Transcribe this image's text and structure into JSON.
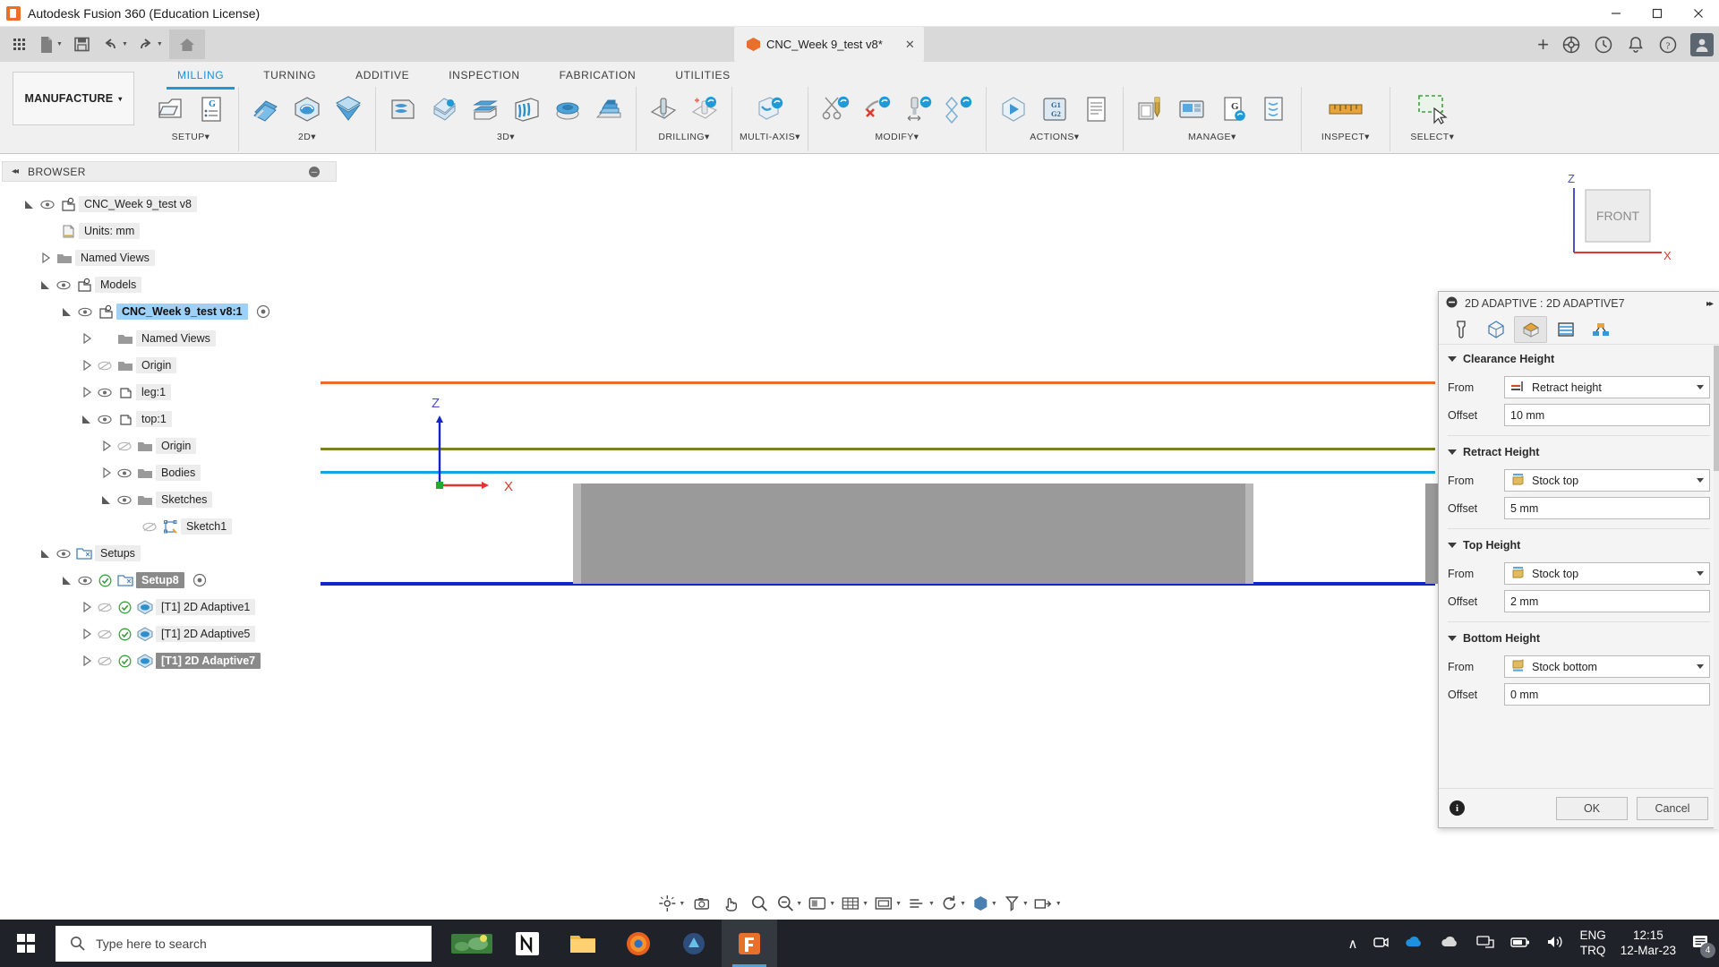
{
  "titlebar": {
    "app_title": "Autodesk Fusion 360 (Education License)",
    "minimize": "─",
    "maximize": "□",
    "close": "✕"
  },
  "quick_access": {
    "items": [
      {
        "name": "app-grid",
        "label": ""
      },
      {
        "name": "new-document",
        "label": ""
      },
      {
        "name": "save",
        "label": ""
      },
      {
        "name": "undo",
        "label": ""
      },
      {
        "name": "redo",
        "label": ""
      },
      {
        "name": "home",
        "label": ""
      }
    ],
    "document_tab": {
      "label": "CNC_Week 9_test v8*",
      "close": "✕"
    },
    "add_tab": "+"
  },
  "ribbon": {
    "workspace": "MANUFACTURE",
    "workspace_caret": "▾",
    "tabs": [
      {
        "label": "MILLING",
        "active": true
      },
      {
        "label": "TURNING",
        "active": false
      },
      {
        "label": "ADDITIVE",
        "active": false
      },
      {
        "label": "INSPECTION",
        "active": false
      },
      {
        "label": "FABRICATION",
        "active": false
      },
      {
        "label": "UTILITIES",
        "active": false
      }
    ],
    "panels": [
      {
        "label": "SETUP",
        "caret": "▾",
        "commands": [
          "setup-icon",
          "generate-nc-program-icon"
        ]
      },
      {
        "label": "2D",
        "caret": "▾",
        "commands": [
          "face-icon",
          "2d-adaptive-icon",
          "2d-pocket-icon"
        ]
      },
      {
        "label": "3D",
        "caret": "▾",
        "commands": [
          "adaptive-clearing-icon",
          "pocket-clearing-icon",
          "horizontal-icon",
          "parallel-icon",
          "contour-icon",
          "ramp-icon"
        ]
      },
      {
        "label": "DRILLING",
        "caret": "▾",
        "commands": [
          "drill-icon",
          "bore-icon"
        ]
      },
      {
        "label": "MULTI-AXIS",
        "caret": "▾",
        "commands": [
          "swarf-icon"
        ]
      },
      {
        "label": "MODIFY",
        "caret": "▾",
        "commands": [
          "trim-icon",
          "delete-icon",
          "extend-icon",
          "align-icon"
        ]
      },
      {
        "label": "ACTIONS",
        "caret": "▾",
        "commands": [
          "simulate-icon",
          "post-process-icon",
          "setup-sheet-icon"
        ]
      },
      {
        "label": "MANAGE",
        "caret": "▾",
        "commands": [
          "tool-library-icon",
          "machine-library-icon",
          "generate-icon",
          "template-icon"
        ]
      },
      {
        "label": "INSPECT",
        "caret": "▾",
        "commands": [
          "measure-icon"
        ]
      },
      {
        "label": "SELECT",
        "caret": "▾",
        "commands": [
          "select-window-icon"
        ]
      }
    ]
  },
  "browser": {
    "header": {
      "collapse": "◂◂",
      "title": "BROWSER",
      "minimize": "─"
    },
    "tree": [
      {
        "label": "CNC_Week 9_test v8",
        "indent": 0,
        "arrow": "expanded",
        "eye": "visible",
        "icon": "component-icon",
        "state": "normal"
      },
      {
        "label": "Units: mm",
        "indent": 1,
        "arrow": "none",
        "eye": "none",
        "icon": "document-icon",
        "state": "normal"
      },
      {
        "label": "Named Views",
        "indent": 1,
        "arrow": "collapsed",
        "eye": "none",
        "icon": "folder-icon",
        "state": "normal"
      },
      {
        "label": "Models",
        "indent": 1,
        "arrow": "expanded",
        "eye": "visible",
        "icon": "component-icon",
        "state": "normal"
      },
      {
        "label": "CNC_Week 9_test v8:1",
        "indent": 2,
        "arrow": "expanded",
        "eye": "visible",
        "icon": "component-icon",
        "state": "selected",
        "target": true
      },
      {
        "label": "Named Views",
        "indent": 3,
        "arrow": "collapsed",
        "eye": "none",
        "icon": "folder-icon",
        "state": "normal"
      },
      {
        "label": "Origin",
        "indent": 3,
        "arrow": "collapsed",
        "eye": "hidden",
        "icon": "folder-icon",
        "state": "normal"
      },
      {
        "label": "leg:1",
        "indent": 3,
        "arrow": "collapsed",
        "eye": "visible",
        "icon": "body-icon",
        "state": "normal"
      },
      {
        "label": "top:1",
        "indent": 3,
        "arrow": "expanded",
        "eye": "visible",
        "icon": "body-icon",
        "state": "normal"
      },
      {
        "label": "Origin",
        "indent": 4,
        "arrow": "collapsed",
        "eye": "hidden",
        "icon": "folder-icon",
        "state": "normal"
      },
      {
        "label": "Bodies",
        "indent": 4,
        "arrow": "collapsed",
        "eye": "visible",
        "icon": "folder-icon",
        "state": "normal"
      },
      {
        "label": "Sketches",
        "indent": 4,
        "arrow": "expanded",
        "eye": "visible",
        "icon": "folder-icon",
        "state": "normal"
      },
      {
        "label": "Sketch1",
        "indent": 5,
        "arrow": "none",
        "eye": "hidden",
        "icon": "sketch-icon",
        "state": "normal"
      },
      {
        "label": "Setups",
        "indent": 1,
        "arrow": "expanded",
        "eye": "visible",
        "icon": "setups-icon",
        "state": "normal"
      },
      {
        "label": "Setup8",
        "indent": 2,
        "arrow": "expanded",
        "eye": "visible",
        "icon": "setup-folder-icon",
        "state": "highlighted",
        "check": true,
        "target": true
      },
      {
        "label": "[T1] 2D Adaptive1",
        "indent": 3,
        "arrow": "collapsed",
        "eye": "hidden",
        "icon": "adaptive-op-icon",
        "state": "normal",
        "check": true
      },
      {
        "label": "[T1] 2D Adaptive5",
        "indent": 3,
        "arrow": "collapsed",
        "eye": "hidden",
        "icon": "adaptive-op-icon",
        "state": "normal",
        "check": true
      },
      {
        "label": "[T1] 2D Adaptive7",
        "indent": 3,
        "arrow": "collapsed",
        "eye": "hidden",
        "icon": "adaptive-op-icon",
        "state": "selected-dark",
        "check": true
      }
    ]
  },
  "canvas": {
    "view_cube_label": "FRONT",
    "axis_z": "Z",
    "axis_x": "X",
    "view_cube_z": "Z",
    "view_cube_x": "X",
    "colors": {
      "clearance_line": "#ef6a33",
      "retract_line": "#7c8020",
      "top_line": "#13a4e0",
      "bottom_line": "#1324c8",
      "stock_body": "#9a9a9a"
    }
  },
  "dialog": {
    "title": "2D ADAPTIVE : 2D ADAPTIVE7",
    "pin": "▸▸",
    "tabs": [
      {
        "name": "tool-tab",
        "active": false
      },
      {
        "name": "geometry-tab",
        "active": false
      },
      {
        "name": "heights-tab",
        "active": true
      },
      {
        "name": "passes-tab",
        "active": false
      },
      {
        "name": "linking-tab",
        "active": false
      }
    ],
    "sections": [
      {
        "title": "Clearance Height",
        "from_label": "From",
        "from_value": "Retract height",
        "from_icon": "retract-height-icon",
        "offset_label": "Offset",
        "offset_value": "10 mm"
      },
      {
        "title": "Retract Height",
        "from_label": "From",
        "from_value": "Stock top",
        "from_icon": "stock-top-icon",
        "offset_label": "Offset",
        "offset_value": "5 mm"
      },
      {
        "title": "Top Height",
        "from_label": "From",
        "from_value": "Stock top",
        "from_icon": "stock-top-icon",
        "offset_label": "Offset",
        "offset_value": "2 mm"
      },
      {
        "title": "Bottom Height",
        "from_label": "From",
        "from_value": "Stock bottom",
        "from_icon": "stock-bottom-icon",
        "offset_label": "Offset",
        "offset_value": "0 mm"
      }
    ],
    "footer": {
      "info": "i",
      "ok": "OK",
      "cancel": "Cancel"
    }
  },
  "view_toolbar": {
    "items": [
      {
        "name": "orbit-icon",
        "caret": "▾"
      },
      {
        "name": "camera-icon",
        "caret": ""
      },
      {
        "name": "pan-icon",
        "caret": ""
      },
      {
        "name": "zoom-icon",
        "caret": ""
      },
      {
        "name": "zoom-fit-icon",
        "caret": "▾"
      },
      {
        "name": "display-settings-icon",
        "caret": "▾"
      },
      {
        "name": "grid-snaps-icon",
        "caret": "▾"
      },
      {
        "name": "viewports-icon",
        "caret": "▾"
      },
      {
        "name": "object-visibility-icon",
        "caret": "▾"
      },
      {
        "name": "refresh-icon",
        "caret": "▾"
      },
      {
        "name": "appearance-icon",
        "caret": "▾"
      },
      {
        "name": "tool-filter-icon",
        "caret": "▾"
      },
      {
        "name": "simulate-view-icon",
        "caret": "▾"
      }
    ]
  },
  "taskbar": {
    "search_placeholder": "Type here to search",
    "apps": [
      {
        "name": "taskbar-weather",
        "active": false
      },
      {
        "name": "taskbar-notion",
        "active": false
      },
      {
        "name": "taskbar-file-explorer",
        "active": false
      },
      {
        "name": "taskbar-firefox",
        "active": false
      },
      {
        "name": "taskbar-fusion-viewer",
        "active": false
      },
      {
        "name": "taskbar-fusion360",
        "active": true
      }
    ],
    "tray": {
      "chevron": "∧",
      "language_top": "ENG",
      "language_bottom": "TRQ",
      "time": "12:15",
      "date": "12-Mar-23",
      "notification_count": "4"
    }
  }
}
